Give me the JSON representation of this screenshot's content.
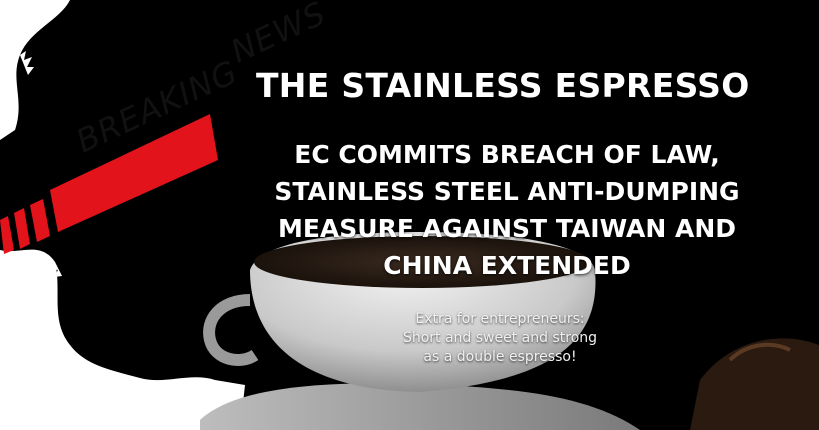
{
  "banner": {
    "tag_word_1": "BREAKING",
    "tag_word_2": "NEWS",
    "brand_title": "THE STAINLESS ESPRESSO",
    "headline_lines": [
      "EC COMMITS BREACH OF LAW,",
      "STAINLESS STEEL ANTI-DUMPING",
      "MEASURE AGAINST TAIWAN AND",
      "CHINA EXTENDED"
    ],
    "subtitle_lines": [
      "Extra for entrepreneurs:",
      "Short and sweet and strong",
      "as a double espresso!"
    ]
  },
  "colors": {
    "background": "#000000",
    "paper": "#ffffff",
    "accent_red": "#e3131b",
    "cup": "#e8e8e8"
  }
}
